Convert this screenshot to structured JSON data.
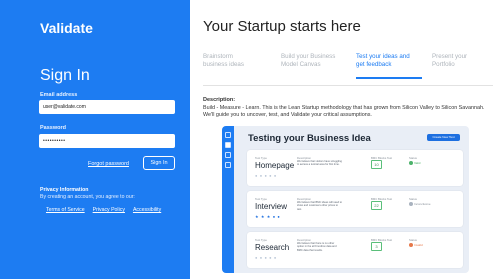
{
  "brand": "Validate",
  "signin": {
    "title": "Sign In",
    "email_label": "Email address",
    "email_value": "user@validate.com",
    "password_label": "Password",
    "password_value": "••••••••••",
    "forgot_label": "Forgot password",
    "button_label": "Sign In"
  },
  "privacy": {
    "heading": "Privacy Information",
    "text": "By creating an account, you agree to our:",
    "links": [
      "Terms of Service",
      "Privacy Policy",
      "Accessibility"
    ]
  },
  "main": {
    "title": "Your Startup starts here",
    "tabs": [
      {
        "line1": "Brainstorm",
        "line2": "business ideas"
      },
      {
        "line1": "Build your Business",
        "line2": "Model Canvas"
      },
      {
        "line1": "Test your ideas and",
        "line2": "get feedback"
      },
      {
        "line1": "Present your",
        "line2": "Portfolio"
      }
    ],
    "active_tab_index": 2,
    "description_label": "Description:",
    "description_text": "Build - Measure - Learn. This is the Lean Startup methodology that has grown from Silicon Valley to Silicon Savannah. We'll guide you to uncover, test, and Validate your critical assumptions."
  },
  "screenshot": {
    "title": "Testing your Business Idea",
    "button_label": "Create New Test",
    "column_headers": {
      "type": "Test Type",
      "description": "Description",
      "tests": "BMC Blocks Test",
      "status": "Status"
    },
    "cards": [
      {
        "name": "Homepage",
        "description": "We believe that visitors have struggling to access a tutorial area for first time.",
        "tests": "10",
        "status": "Valid",
        "status_color": "#4cb36b",
        "rating_dots": "● ● ● ● ●"
      },
      {
        "name": "Interview",
        "description": "We believe that BMC ideas will need to show and customers other prices to test.",
        "tests": "22",
        "status": "Inconclusive",
        "status_color": "#a9b3bf",
        "rating_dots": "★ ★ ★ ● ●"
      },
      {
        "name": "Research",
        "description": "We believe that there is no other option in the all 9 textbox data and BMC data that results.",
        "tests": "3",
        "status": "Invalid",
        "status_color": "#e6784a",
        "rating_dots": "● ● ● ● ●"
      }
    ]
  },
  "colors": {
    "brand_blue": "#1d7cf2",
    "active_tab": "#1d7cf2"
  }
}
